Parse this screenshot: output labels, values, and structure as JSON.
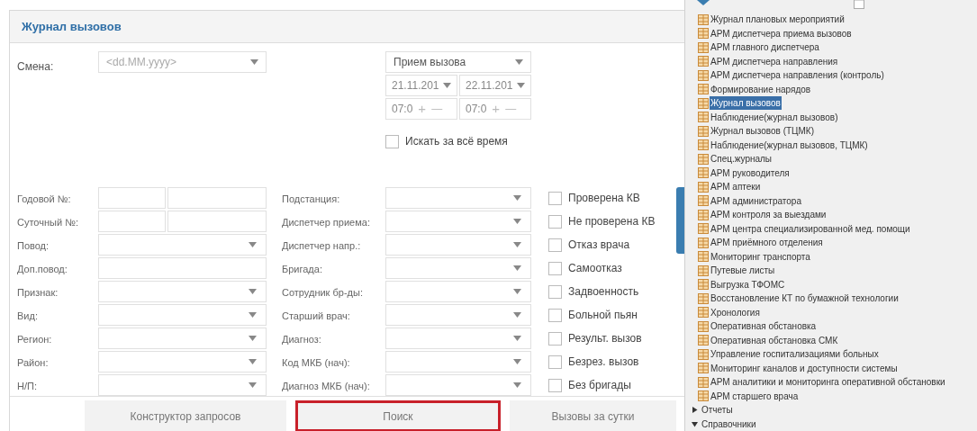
{
  "title": "Журнал вызовов",
  "shift": {
    "label": "Смена:",
    "placeholder": "<dd.MM.yyyy>"
  },
  "period": {
    "mode": "Прием вызова",
    "date_from": "21.11.201",
    "date_to": "22.11.201",
    "times": [
      {
        "value": "07:0",
        "up": "+",
        "down": "—"
      },
      {
        "value": "07:0",
        "up": "+",
        "down": "—"
      }
    ],
    "all_time": {
      "label": "Искать за всё время",
      "checked": false
    }
  },
  "rows": [
    {
      "label": "Годовой №:",
      "kind": "split",
      "middle": "Подстанция:",
      "check": {
        "label": "Проверена КВ",
        "checked": false
      }
    },
    {
      "label": "Суточный №:",
      "kind": "split",
      "middle": "Диспетчер приема:",
      "check": {
        "label": "Не проверена КВ",
        "checked": false
      }
    },
    {
      "label": "Повод:",
      "kind": "select",
      "middle": "Диспетчер напр.:",
      "check": {
        "label": "Отказ врача",
        "checked": false
      }
    },
    {
      "label": "Доп.повод:",
      "kind": "text",
      "middle": "Бригада:",
      "check": {
        "label": "Самоотказ",
        "checked": false
      }
    },
    {
      "label": "Признак:",
      "kind": "select",
      "middle": "Сотрудник бр-ды:",
      "check": {
        "label": "Задвоенность",
        "checked": false
      }
    },
    {
      "label": "Вид:",
      "kind": "select",
      "middle": "Старший врач:",
      "check": {
        "label": "Больной пьян",
        "checked": false
      }
    },
    {
      "label": "Регион:",
      "kind": "select",
      "middle": "Диагноз:",
      "check": {
        "label": "Результ. вызов",
        "checked": false
      }
    },
    {
      "label": "Район:",
      "kind": "select",
      "middle": "Код МКБ (нач):",
      "check": {
        "label": "Безрез. вызов",
        "checked": false
      }
    },
    {
      "label": "Н/П:",
      "kind": "select",
      "middle": "Диагноз МКБ (нач):",
      "check": {
        "label": "Без бригады",
        "checked": false
      }
    }
  ],
  "buttons": [
    {
      "label": "Конструктор запросов",
      "highlighted": false
    },
    {
      "label": "Поиск",
      "highlighted": true
    },
    {
      "label": "Вызовы за сутки",
      "highlighted": false
    }
  ],
  "tree": {
    "items": [
      {
        "label": "Журнал плановых мероприятий",
        "selected": false
      },
      {
        "label": "АРМ диспетчера приема вызовов",
        "selected": false
      },
      {
        "label": "АРМ главного диспетчера",
        "selected": false
      },
      {
        "label": "АРМ диспетчера направления",
        "selected": false
      },
      {
        "label": "АРМ диспетчера направления (контроль)",
        "selected": false
      },
      {
        "label": "Формирование нарядов",
        "selected": false
      },
      {
        "label": "Журнал вызовов",
        "selected": true
      },
      {
        "label": "Наблюдение(журнал вызовов)",
        "selected": false
      },
      {
        "label": "Журнал вызовов (ТЦМК)",
        "selected": false
      },
      {
        "label": "Наблюдение(журнал вызовов, ТЦМК)",
        "selected": false
      },
      {
        "label": "Спец.журналы",
        "selected": false
      },
      {
        "label": "АРМ руководителя",
        "selected": false
      },
      {
        "label": "АРМ аптеки",
        "selected": false
      },
      {
        "label": "АРМ администратора",
        "selected": false
      },
      {
        "label": "АРМ контроля за выездами",
        "selected": false
      },
      {
        "label": "АРМ центра специализированной мед. помощи",
        "selected": false
      },
      {
        "label": "АРМ приёмного отделения",
        "selected": false
      },
      {
        "label": "Мониторинг транспорта",
        "selected": false
      },
      {
        "label": "Путевые листы",
        "selected": false
      },
      {
        "label": "Выгрузка ТФОМС",
        "selected": false
      },
      {
        "label": "Восстановление КТ по бумажной технологии",
        "selected": false
      },
      {
        "label": "Хронология",
        "selected": false
      },
      {
        "label": "Оперативная обстановка",
        "selected": false
      },
      {
        "label": "Оперативная обстановка СМК",
        "selected": false
      },
      {
        "label": "Управление госпитализациями больных",
        "selected": false
      },
      {
        "label": "Мониторинг каналов и доступности системы",
        "selected": false
      },
      {
        "label": "АРМ аналитики и мониторинга оперативной обстановки",
        "selected": false
      },
      {
        "label": "АРМ старшего врача",
        "selected": false
      }
    ],
    "folders": [
      {
        "label": "Отчеты",
        "expanded": false
      },
      {
        "label": "Справочники",
        "expanded": true
      }
    ]
  }
}
